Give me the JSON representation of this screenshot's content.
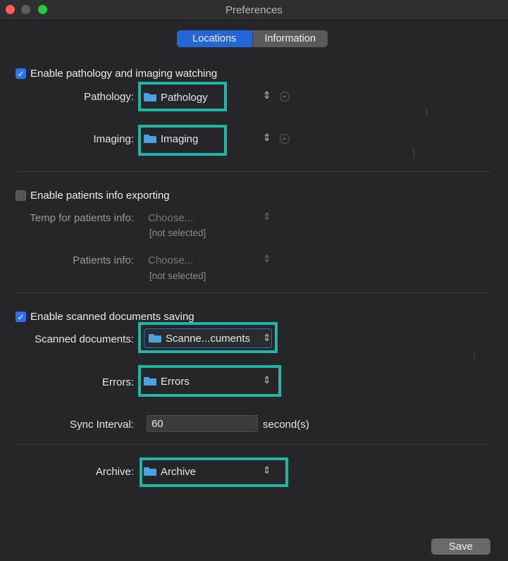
{
  "window": {
    "title": "Preferences"
  },
  "tabs": [
    {
      "label": "Locations",
      "active": true
    },
    {
      "label": "Information",
      "active": false
    }
  ],
  "watching": {
    "checkbox_label": "Enable pathology and imaging watching",
    "checked": true,
    "pathology": {
      "label": "Pathology:",
      "value": "Pathology"
    },
    "imaging": {
      "label": "Imaging:",
      "value": "Imaging"
    }
  },
  "export": {
    "checkbox_label": "Enable patients info exporting",
    "checked": false,
    "temp": {
      "label": "Temp for patients info:",
      "placeholder": "Choose...",
      "status": "[not selected]"
    },
    "patients": {
      "label": "Patients info:",
      "placeholder": "Choose...",
      "status": "[not selected]"
    }
  },
  "scanned": {
    "checkbox_label": "Enable scanned documents saving",
    "checked": true,
    "documents": {
      "label": "Scanned documents:",
      "value": "Scanne...cuments"
    },
    "errors": {
      "label": "Errors:",
      "value": "Errors"
    },
    "sync": {
      "label": "Sync Interval:",
      "value": "60",
      "unit": "second(s)"
    }
  },
  "archive": {
    "label": "Archive:",
    "value": "Archive"
  },
  "footer": {
    "save_label": "Save"
  },
  "colors": {
    "accent": "#2466d8",
    "highlight": "#1fb6a6",
    "folder": "#4aa3e0"
  }
}
